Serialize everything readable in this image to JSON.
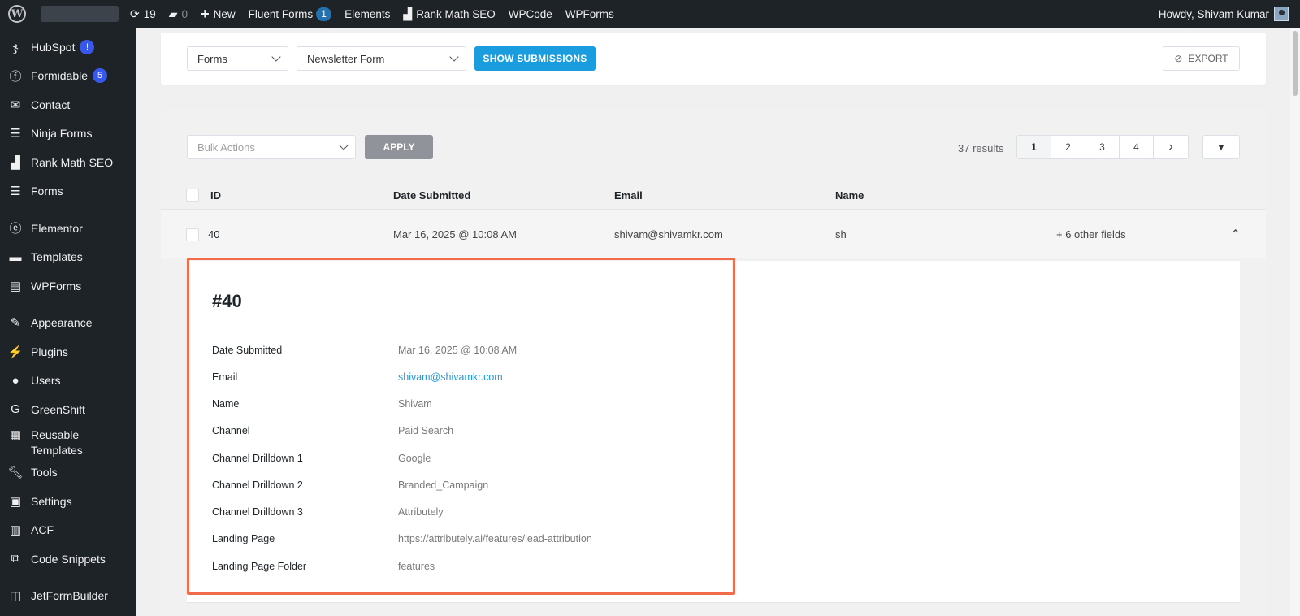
{
  "admin_bar": {
    "updates_count": "19",
    "comments_count": "0",
    "new_label": "New",
    "fluent_forms_label": "Fluent Forms",
    "fluent_forms_badge": "1",
    "elements_label": "Elements",
    "rank_math_label": "Rank Math SEO",
    "wpcode_label": "WPCode",
    "wpforms_label": "WPForms",
    "howdy": "Howdy, Shivam Kumar"
  },
  "sidebar": {
    "items": [
      {
        "label": "HubSpot",
        "icon": "hubspot-icon",
        "badge": "!"
      },
      {
        "label": "Formidable",
        "icon": "formidable-icon",
        "badge": "5"
      },
      {
        "label": "Contact",
        "icon": "envelope-icon"
      },
      {
        "label": "Ninja Forms",
        "icon": "form-list-icon"
      },
      {
        "label": "Rank Math SEO",
        "icon": "chart-icon"
      },
      {
        "label": "Forms",
        "icon": "form-list-icon"
      },
      {
        "label": "Elementor",
        "icon": "elementor-icon"
      },
      {
        "label": "Templates",
        "icon": "folder-icon"
      },
      {
        "label": "WPForms",
        "icon": "wpforms-icon"
      },
      {
        "label": "Appearance",
        "icon": "brush-icon"
      },
      {
        "label": "Plugins",
        "icon": "plug-icon"
      },
      {
        "label": "Users",
        "icon": "user-icon"
      },
      {
        "label": "GreenShift",
        "icon": "greenshift-icon"
      },
      {
        "label": "Reusable Templates",
        "icon": "grid-icon"
      },
      {
        "label": "Tools",
        "icon": "wrench-icon"
      },
      {
        "label": "Settings",
        "icon": "settings-icon"
      },
      {
        "label": "ACF",
        "icon": "acf-icon"
      },
      {
        "label": "Code Snippets",
        "icon": "code-icon"
      },
      {
        "label": "JetFormBuilder",
        "icon": "jet-icon"
      }
    ]
  },
  "toolbar": {
    "forms_select": "Forms",
    "form_select": "Newsletter Form",
    "show_submissions": "SHOW SUBMISSIONS",
    "export": "EXPORT"
  },
  "list_controls": {
    "bulk_actions_placeholder": "Bulk Actions",
    "apply": "APPLY",
    "results": "37 results",
    "pages": [
      "1",
      "2",
      "3",
      "4"
    ],
    "current_page": "1"
  },
  "table": {
    "columns": [
      "ID",
      "Date Submitted",
      "Email",
      "Name"
    ],
    "rows": [
      {
        "id": "40",
        "date": "Mar 16, 2025 @ 10:08 AM",
        "email": "shivam@shivamkr.com",
        "name": "sh",
        "extra": "+ 6 other fields"
      }
    ]
  },
  "detail": {
    "title": "#40",
    "fields": [
      {
        "label": "Date Submitted",
        "value": "Mar 16, 2025 @ 10:08 AM"
      },
      {
        "label": "Email",
        "value": "shivam@shivamkr.com",
        "link": true
      },
      {
        "label": "Name",
        "value": "Shivam"
      },
      {
        "label": "Channel",
        "value": "Paid Search"
      },
      {
        "label": "Channel Drilldown 1",
        "value": "Google"
      },
      {
        "label": "Channel Drilldown 2",
        "value": "Branded_Campaign"
      },
      {
        "label": "Channel Drilldown 3",
        "value": "Attributely"
      },
      {
        "label": "Landing Page",
        "value": "https://attributely.ai/features/lead-attribution"
      },
      {
        "label": "Landing Page Folder",
        "value": "features"
      }
    ]
  },
  "colors": {
    "admin_dark": "#1d2327",
    "primary_blue": "#1a9dde",
    "highlight_orange": "#f26b4a",
    "badge_blue": "#3858e9"
  }
}
